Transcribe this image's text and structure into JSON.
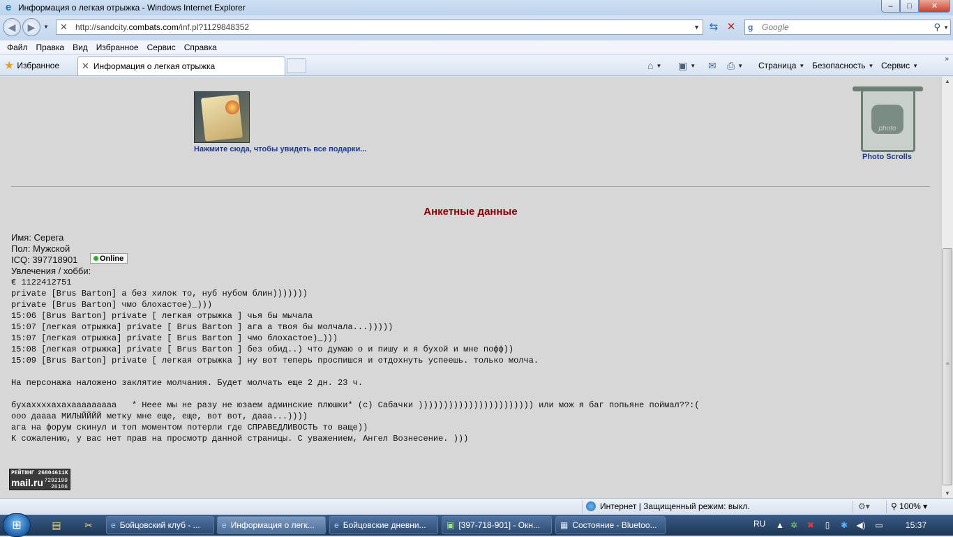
{
  "window": {
    "title": "Информация о легкая отрыжка - Windows Internet Explorer",
    "controls": {
      "minimize": "–",
      "maximize": "□",
      "close": "✕"
    }
  },
  "address": {
    "url_prefix": "http://sandcity.",
    "url_domain": "combats.com",
    "url_suffix": "/inf.pl?1129848352",
    "search_placeholder": "Google"
  },
  "menu": [
    "Файл",
    "Правка",
    "Вид",
    "Избранное",
    "Сервис",
    "Справка"
  ],
  "favorites": {
    "label": "Избранное",
    "tab_title": "Информация о легкая отрыжка"
  },
  "commandbar": {
    "page": "Страница",
    "safety": "Безопасность",
    "tools": "Сервис"
  },
  "page": {
    "gift_link": "Нажмите сюда, чтобы увидеть все подарки...",
    "photo_label": "Photo Scrolls",
    "photo_overlay": "photo",
    "section_title": "Анкетные данные",
    "name_line": "Имя: Серега",
    "gender_line": "Пол: Мужской",
    "icq_line": "ICQ: 397718901",
    "icq_badge": "Online",
    "hobby_label": "Увлечения / хобби:",
    "hobby_lines": [
      "€ 1122412751",
      "private [Brus Barton] а без хилок то, нуб нубом блин)))))))",
      "private [Brus Barton] чмо блохастое)_)))",
      "15:06 [Brus Barton] private [ легкая отрыжка ] чья бы мычала",
      "15:07 [легкая отрыжка] private [ Brus Barton ] ага а твоя бы молчала...)))))",
      "15:07 [легкая отрыжка] private [ Brus Barton ] чмо блохастое)_)))",
      "15:08 [легкая отрыжка] private [ Brus Barton ] без обид..) что думаю о и пишу и я бухой и мне пофф))",
      "15:09 [Brus Barton] private [ легкая отрыжка ] ну вот теперь проспишся и отдохнуть успеешь. только молча."
    ],
    "silence_line": "На персонажа наложено заклятие молчания. Будет молчать еще 2 дн. 23 ч.",
    "tail_lines": [
      "бухаххххахахааааааааа   * Неее мы не разу не юзаем админские плюшки* (с) Сабачки ))))))))))))))))))))))) или мож я баг попьяне поймал??:(",
      "ооо даааа МИЛЫЙЙЙЙ метку мне еще, еще, вот вот, дааа...))))",
      "ага на форум скинул и топ моментом потерли где СПРАВЕДЛИВОСТЬ то ваще))",
      "К сожалению, у вас нет прав на просмотр данной страницы. С уважением, Ангел Вознесение. )))"
    ],
    "rating": {
      "line1": "РЕЙТИНГ 26804611K",
      "brand": "mail.ru",
      "n1": "7292199",
      "n2": "26106"
    }
  },
  "status": {
    "zone": "Интернет | Защищенный режим: выкл.",
    "zoom": "100%"
  },
  "taskbar": {
    "tasks": [
      "Бойцовский клуб - ...",
      "Информация о легк...",
      "Бойцовские дневни...",
      "[397-718-901] - Окн...",
      "Состояние - Bluetoo..."
    ],
    "lang": "RU",
    "clock": "15:37"
  },
  "colors": {
    "section_title": "#8b0000",
    "link": "#1c3a8f",
    "content_bg": "#d7d7d7"
  }
}
